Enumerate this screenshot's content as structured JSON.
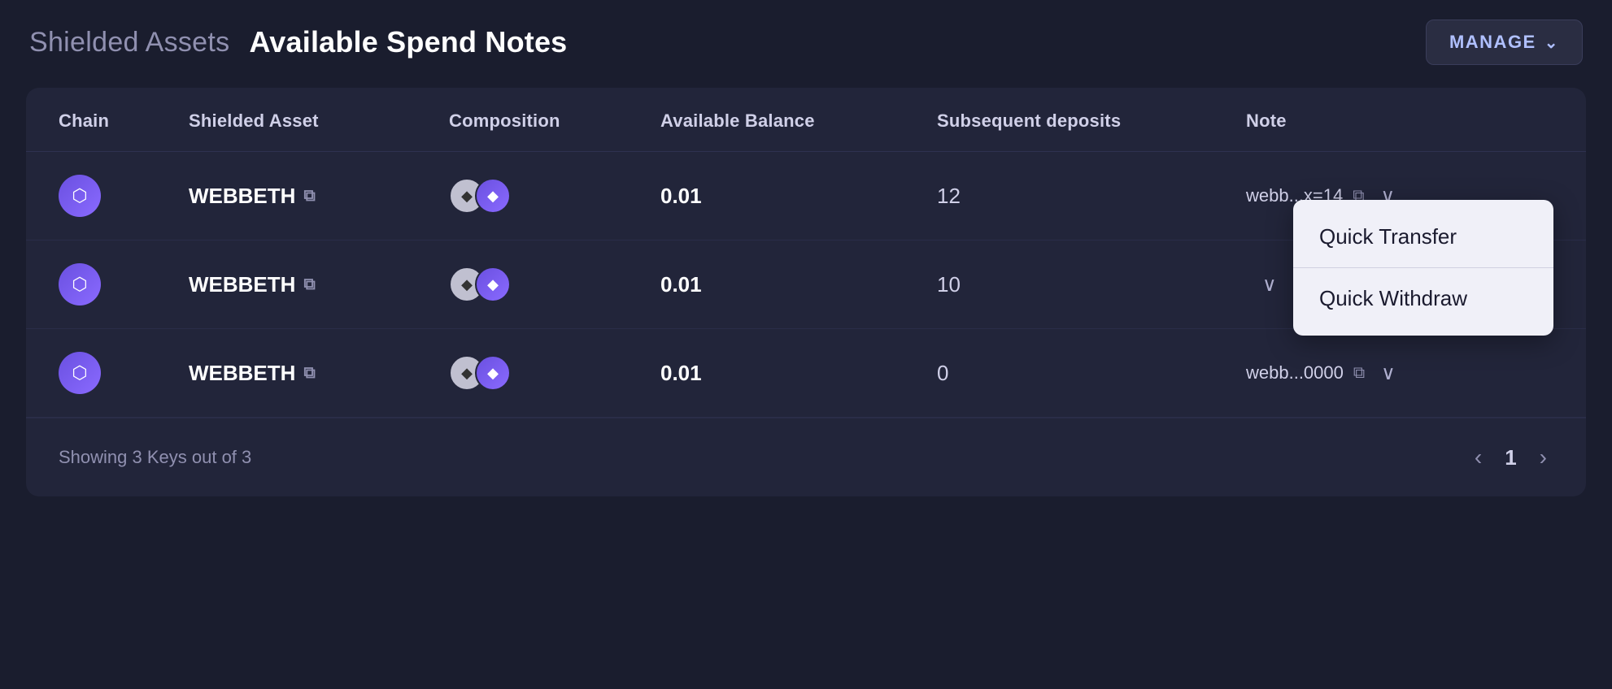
{
  "header": {
    "shielded_assets_label": "Shielded Assets",
    "available_notes_label": "Available Spend Notes",
    "manage_button_label": "MANAGE"
  },
  "table": {
    "columns": [
      {
        "id": "chain",
        "label": "Chain"
      },
      {
        "id": "shielded_asset",
        "label": "Shielded Asset"
      },
      {
        "id": "composition",
        "label": "Composition"
      },
      {
        "id": "available_balance",
        "label": "Available Balance"
      },
      {
        "id": "subsequent_deposits",
        "label": "Subsequent deposits"
      },
      {
        "id": "note",
        "label": "Note"
      }
    ],
    "rows": [
      {
        "chain": "ETH",
        "shielded_asset": "WEBBETH",
        "available_balance": "0.01",
        "subsequent_deposits": "12",
        "note": "webb...x=14",
        "has_dropdown": true,
        "dropdown_open": true
      },
      {
        "chain": "ETH",
        "shielded_asset": "WEBBETH",
        "available_balance": "0.01",
        "subsequent_deposits": "10",
        "note": "",
        "has_dropdown": true,
        "dropdown_open": false
      },
      {
        "chain": "ETH",
        "shielded_asset": "WEBBETH",
        "available_balance": "0.01",
        "subsequent_deposits": "0",
        "note": "webb...0000",
        "has_dropdown": true,
        "dropdown_open": false
      }
    ],
    "dropdown_items": [
      {
        "label": "Quick Transfer"
      },
      {
        "label": "Quick Withdraw"
      }
    ]
  },
  "footer": {
    "showing_text": "Showing 3 Keys out of 3",
    "current_page": "1"
  },
  "icons": {
    "eth_symbol": "◆",
    "external_link": "↗",
    "copy": "⧉",
    "chevron_down": "∨",
    "chevron_left": "‹",
    "chevron_right": "›",
    "manage_chevron": "∨"
  }
}
